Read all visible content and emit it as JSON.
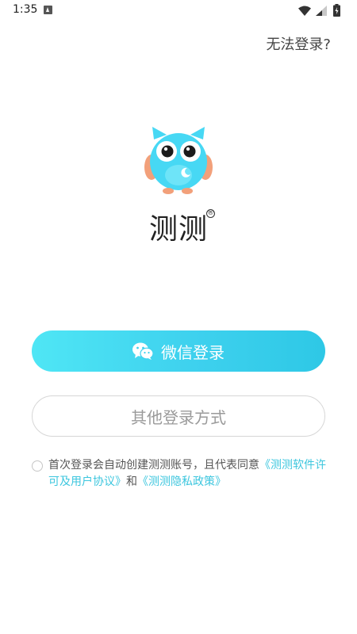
{
  "status_bar": {
    "time": "1:35"
  },
  "header": {
    "help_link": "无法登录?"
  },
  "brand": {
    "app_name": "测测",
    "registered_mark": "®",
    "owl_color": "#47d8f4",
    "wing_color": "#f2a07a"
  },
  "buttons": {
    "wechat_login": "微信登录",
    "other_login": "其他登录方式"
  },
  "agreement": {
    "text_prefix": "首次登录会自动创建测测账号，且代表同意",
    "license_link": "《测测软件许可及用户协议》",
    "conjunction": "和",
    "privacy_link": "《测测隐私政策》"
  },
  "colors": {
    "accent": "#3ed1ee",
    "link": "#3cc6de"
  }
}
